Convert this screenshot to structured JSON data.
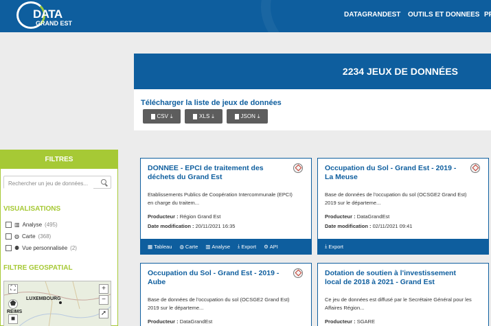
{
  "header": {
    "logo_top": "DATA",
    "logo_bottom": "GRAND EST",
    "nav": [
      "DATAGRANDEST",
      "OUTILS ET DONNEES",
      "PR"
    ]
  },
  "banner": {
    "count_text": "2234 JEUX DE DONNÉES"
  },
  "download": {
    "title": "Télécharger la liste de jeux de données",
    "buttons": [
      "CSV",
      "XLS",
      "JSON"
    ]
  },
  "filters": {
    "title": "FILTRES",
    "search_placeholder": "Rechercher un jeu de données...",
    "visualisations_title": "VISUALISATIONS",
    "visualisations": [
      {
        "label": "Analyse",
        "count": "(495)",
        "icon": "bar-chart-icon"
      },
      {
        "label": "Carte",
        "count": "(368)",
        "icon": "globe-icon"
      },
      {
        "label": "Vue personnalisée",
        "count": "(2)",
        "icon": "people-icon"
      }
    ],
    "geo_title": "FILTRE GEOSPATIAL",
    "map_labels": [
      "LUXEMBOURG",
      "REIMS"
    ]
  },
  "datasets": [
    {
      "title": "DONNEE - EPCI de traitement des déchets du Grand Est",
      "description": "Etablissements Publics de Coopération Intercommunale (EPCI) en charge du traitem...",
      "producer_label": "Producteur :",
      "producer": "Région Grand Est",
      "date_label": "Date modification :",
      "date": "20/11/2021 16:35",
      "actions": [
        "Tableau",
        "Carte",
        "Analyse",
        "Export",
        "API"
      ]
    },
    {
      "title": "Occupation du Sol - Grand Est - 2019 - La Meuse",
      "description": "Base de données de l'occupation du sol (OCSGE2 Grand Est) 2019 sur le départeme...",
      "producer_label": "Producteur :",
      "producer": "DataGrandEst",
      "date_label": "Date modification :",
      "date": "02/11/2021 09:41",
      "actions": [
        "Export"
      ]
    },
    {
      "title": "Occupation du Sol - Grand Est - 2019 - Aube",
      "description": "Base de données de l'occupation du sol (OCSGE2 Grand Est) 2019 sur le départeme...",
      "producer_label": "Producteur :",
      "producer": "DataGrandEst"
    },
    {
      "title": "Dotation de soutien à l'investissement local de 2018 à 2021 - Grand Est",
      "description": "Ce jeu de données est diffusé par le Secrétaire Général pour les Affaires Région...",
      "producer_label": "Producteur :",
      "producer": "SGARE"
    }
  ],
  "colors": {
    "primary": "#0e5e9e",
    "accent": "#a6c935",
    "button": "#5d5d5d"
  }
}
